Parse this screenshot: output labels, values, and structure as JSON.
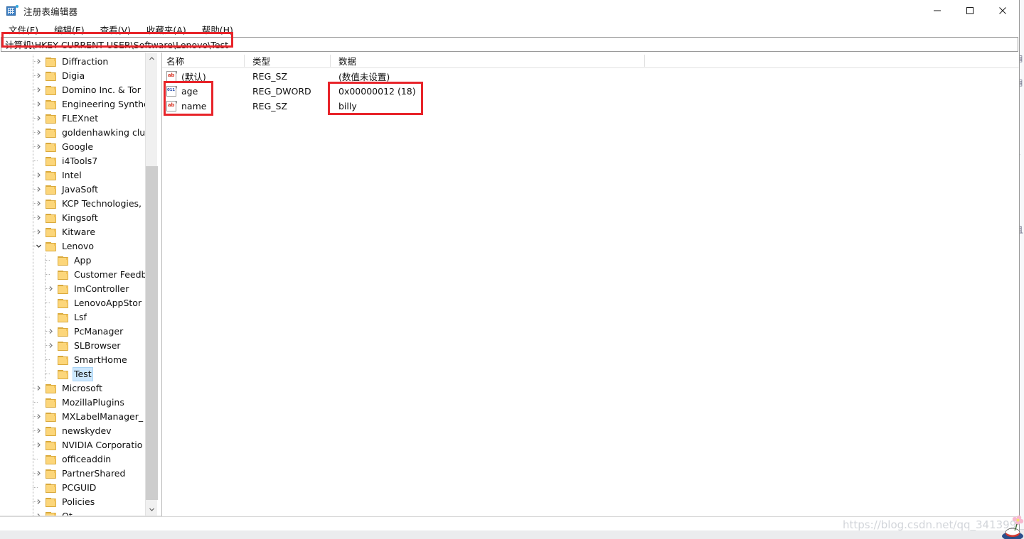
{
  "window": {
    "title": "注册表编辑器",
    "icon": "registry-editor-icon",
    "controls": {
      "minimize": "minimize-icon",
      "maximize": "maximize-icon",
      "close": "close-icon"
    }
  },
  "menubar": {
    "items": [
      {
        "label": "文件(F)",
        "name": "menu-file"
      },
      {
        "label": "编辑(E)",
        "name": "menu-edit"
      },
      {
        "label": "查看(V)",
        "name": "menu-view"
      },
      {
        "label": "收藏夹(A)",
        "name": "menu-favorites"
      },
      {
        "label": "帮助(H)",
        "name": "menu-help"
      }
    ]
  },
  "address": {
    "value": "计算机\\HKEY CURRENT USER\\Software\\Lenovo\\Test",
    "placeholder": "计算机\\"
  },
  "tree": {
    "items": [
      {
        "label": "Diffraction",
        "indent": 0,
        "expander": "collapsed"
      },
      {
        "label": "Digia",
        "indent": 0,
        "expander": "collapsed"
      },
      {
        "label": "Domino Inc. & Tor",
        "indent": 0,
        "expander": "collapsed"
      },
      {
        "label": "Engineering Synthe",
        "indent": 0,
        "expander": "collapsed"
      },
      {
        "label": "FLEXnet",
        "indent": 0,
        "expander": "collapsed"
      },
      {
        "label": "goldenhawking clu",
        "indent": 0,
        "expander": "collapsed"
      },
      {
        "label": "Google",
        "indent": 0,
        "expander": "collapsed"
      },
      {
        "label": "i4Tools7",
        "indent": 0,
        "expander": "none"
      },
      {
        "label": "Intel",
        "indent": 0,
        "expander": "collapsed"
      },
      {
        "label": "JavaSoft",
        "indent": 0,
        "expander": "collapsed"
      },
      {
        "label": "KCP Technologies,",
        "indent": 0,
        "expander": "collapsed"
      },
      {
        "label": "Kingsoft",
        "indent": 0,
        "expander": "collapsed"
      },
      {
        "label": "Kitware",
        "indent": 0,
        "expander": "collapsed"
      },
      {
        "label": "Lenovo",
        "indent": 0,
        "expander": "expanded"
      },
      {
        "label": "App",
        "indent": 1,
        "expander": "none"
      },
      {
        "label": "Customer Feedb",
        "indent": 1,
        "expander": "none"
      },
      {
        "label": "ImController",
        "indent": 1,
        "expander": "collapsed"
      },
      {
        "label": "LenovoAppStor",
        "indent": 1,
        "expander": "none"
      },
      {
        "label": "Lsf",
        "indent": 1,
        "expander": "none"
      },
      {
        "label": "PcManager",
        "indent": 1,
        "expander": "collapsed"
      },
      {
        "label": "SLBrowser",
        "indent": 1,
        "expander": "collapsed"
      },
      {
        "label": "SmartHome",
        "indent": 1,
        "expander": "none"
      },
      {
        "label": "Test",
        "indent": 1,
        "expander": "none",
        "selected": true
      },
      {
        "label": "Microsoft",
        "indent": 0,
        "expander": "collapsed"
      },
      {
        "label": "MozillaPlugins",
        "indent": 0,
        "expander": "none"
      },
      {
        "label": "MXLabelManager_",
        "indent": 0,
        "expander": "collapsed"
      },
      {
        "label": "newskydev",
        "indent": 0,
        "expander": "collapsed"
      },
      {
        "label": "NVIDIA Corporatio",
        "indent": 0,
        "expander": "collapsed"
      },
      {
        "label": "officeaddin",
        "indent": 0,
        "expander": "none"
      },
      {
        "label": "PartnerShared",
        "indent": 0,
        "expander": "collapsed"
      },
      {
        "label": "PCGUID",
        "indent": 0,
        "expander": "none"
      },
      {
        "label": "Policies",
        "indent": 0,
        "expander": "collapsed"
      },
      {
        "label": "Qt",
        "indent": 0,
        "expander": "collapsed"
      }
    ],
    "scrollbars": {
      "vertical_up": "scroll-up-icon",
      "vertical_down": "scroll-down-icon",
      "horizontal_left": "scroll-left-icon",
      "horizontal_right": "scroll-right-icon"
    }
  },
  "values": {
    "columns": [
      {
        "label": "名称",
        "name": "column-name"
      },
      {
        "label": "类型",
        "name": "column-type"
      },
      {
        "label": "数据",
        "name": "column-data"
      }
    ],
    "rows": [
      {
        "name": "(默认)",
        "icon": "string-value-icon",
        "icon_tag": "ab",
        "type": "REG_SZ",
        "data": "(数值未设置)"
      },
      {
        "name": "age",
        "icon": "dword-value-icon",
        "icon_tag": "011",
        "type": "REG_DWORD",
        "data": "0x00000012 (18)"
      },
      {
        "name": "name",
        "icon": "string-value-icon",
        "icon_tag": "ab",
        "type": "REG_SZ",
        "data": "billy"
      }
    ]
  },
  "annotations": {
    "color": "#e8242a",
    "boxes": [
      {
        "name": "address-path-highlight",
        "target": "address bar path"
      },
      {
        "name": "value-names-highlight",
        "target": "age / name value names"
      },
      {
        "name": "value-data-highlight",
        "target": "0x00000012 (18) / billy data"
      }
    ]
  },
  "watermark": {
    "text": "https://blog.csdn.net/qq_341399"
  }
}
